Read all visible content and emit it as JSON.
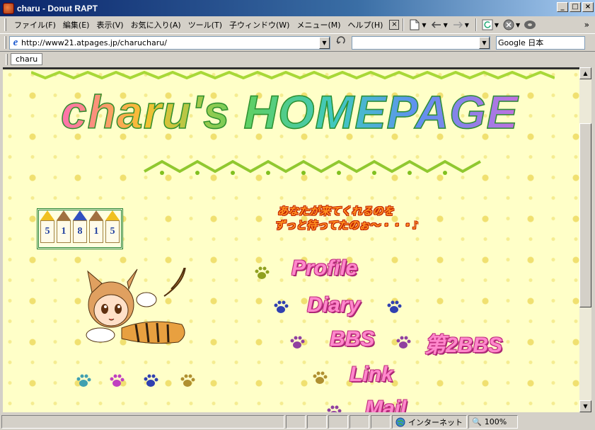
{
  "window": {
    "title": "charu - Donut RAPT",
    "minimize": "_",
    "maximize": "□",
    "close": "×"
  },
  "menu": {
    "items": [
      "ファイル(F)",
      "編集(E)",
      "表示(V)",
      "お気に入り(A)",
      "ツール(T)",
      "子ウィンドウ(W)",
      "メニュー(M)",
      "ヘルプ(H)"
    ],
    "close": "×"
  },
  "address": {
    "url": "http://www21.atpages.jp/charucharu/",
    "search_engine": "Google 日本"
  },
  "tabs": [
    {
      "label": "charu"
    }
  ],
  "page": {
    "title": "charu's HOMEPAGE",
    "counter_digits": [
      "5",
      "1",
      "8",
      "1",
      "5"
    ],
    "welcome_line1": "あなたが来てくれるのを",
    "welcome_line2": "ずっと待ってたのぉ～・・・♪",
    "nav": {
      "profile": "Profile",
      "diary": "Diary",
      "bbs": "BBS",
      "bbs2": "第2BBS",
      "link": "Link",
      "mail": "Mail"
    }
  },
  "status": {
    "zone": "インターネット",
    "zoom": "100%"
  },
  "colors": {
    "page_bg": "#ffffc8",
    "title_outline": "#309030",
    "nav_pink": "#ff88cc"
  }
}
